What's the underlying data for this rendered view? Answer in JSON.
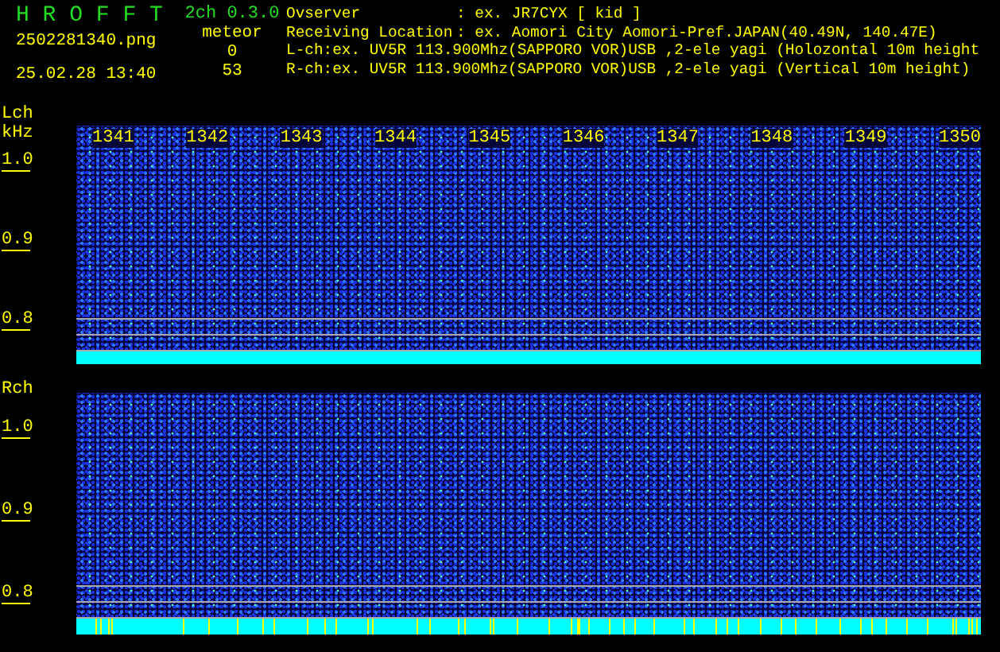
{
  "app": {
    "title": "H R O F F T",
    "version": "2ch 0.3.0",
    "filename": "2502281340.png",
    "timestamp": "25.02.28 13:40"
  },
  "meteor": {
    "label": "meteor",
    "counts": [
      "0",
      "53"
    ]
  },
  "observer": {
    "label": "Ovserver",
    "value": ": ex. JR7CYX [ kid ]"
  },
  "location": {
    "label": "Receiving Location",
    "value": ": ex. Aomori City Aomori-Pref.JAPAN(40.49N, 140.47E)"
  },
  "channels": [
    "L-ch:ex. UV5R 113.900Mhz(SAPPORO VOR)USB ,2-ele yagi (Holozontal 10m height",
    "R-ch:ex. UV5R 113.900Mhz(SAPPORO VOR)USB ,2-ele yagi (Vertical 10m height)"
  ],
  "panels": [
    {
      "label": "Lch",
      "unit": "kHz",
      "time_labels": [
        "1341",
        "1342",
        "1343",
        "1344",
        "1345",
        "1346",
        "1347",
        "1348",
        "1349",
        "1350"
      ],
      "y_labels": [
        "1.0",
        "0.9",
        "0.8"
      ],
      "detections": false
    },
    {
      "label": "Rch",
      "y_labels": [
        "1.0",
        "0.9",
        "0.8"
      ],
      "detections": true
    }
  ]
}
